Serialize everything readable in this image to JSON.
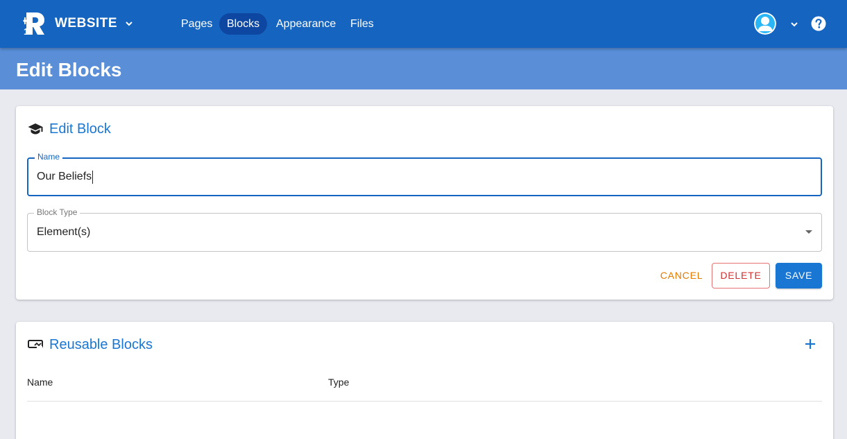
{
  "header": {
    "site_name": "WEBSITE",
    "nav": [
      {
        "label": "Pages",
        "active": false
      },
      {
        "label": "Blocks",
        "active": true
      },
      {
        "label": "Appearance",
        "active": false
      },
      {
        "label": "Files",
        "active": false
      }
    ],
    "icons": {
      "logo": "r1-logo",
      "site_menu": "chevron-down-icon",
      "avatar": "user-avatar",
      "account_menu": "chevron-down-icon",
      "help": "help-circle-icon"
    }
  },
  "page": {
    "title": "Edit Blocks"
  },
  "edit_block": {
    "title": "Edit Block",
    "icon": "school-icon",
    "name_field": {
      "label": "Name",
      "value": "Our Beliefs"
    },
    "type_field": {
      "label": "Block Type",
      "value": "Element(s)"
    },
    "buttons": {
      "cancel": "CANCEL",
      "delete": "DELETE",
      "save": "SAVE"
    }
  },
  "reusable_blocks": {
    "title": "Reusable Blocks",
    "icon": "block-icon",
    "add_icon": "plus-icon",
    "columns": [
      "Name",
      "Type"
    ],
    "rows": []
  },
  "colors": {
    "header_bg": "#1565c0",
    "title_bar_bg": "#5a8fd8",
    "accent": "#1976d2",
    "cancel": "#e07a00",
    "delete": "#d32f2f"
  }
}
